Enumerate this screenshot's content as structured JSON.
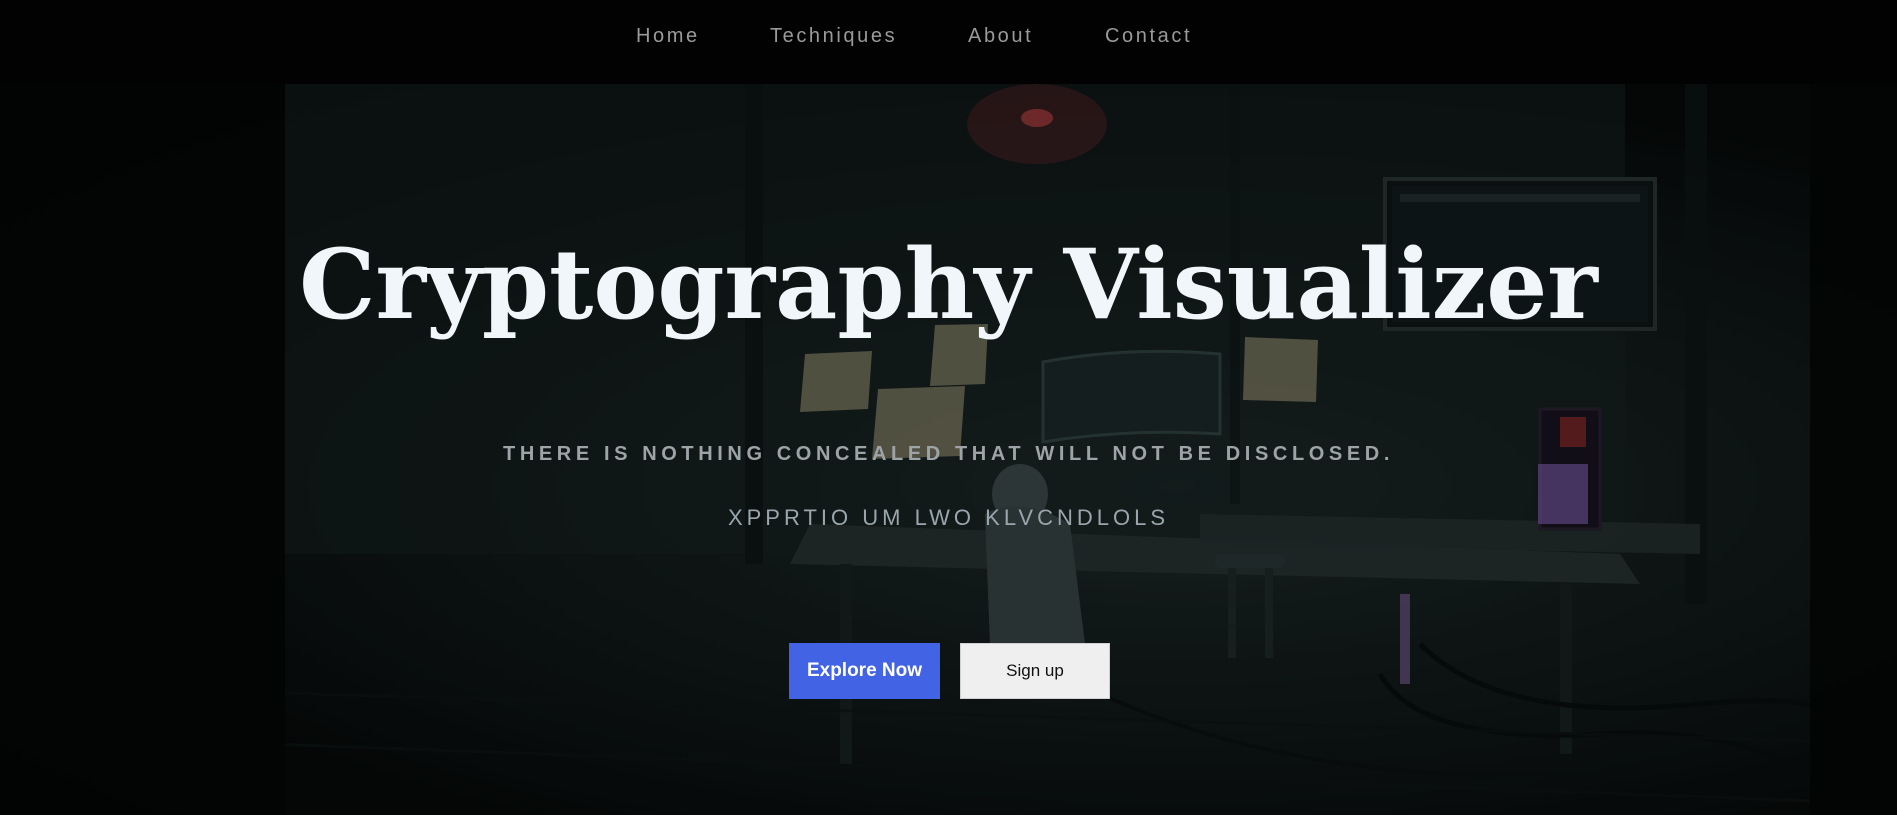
{
  "nav": {
    "items": [
      {
        "label": "Home"
      },
      {
        "label": "Techniques"
      },
      {
        "label": "About"
      },
      {
        "label": "Contact"
      }
    ]
  },
  "hero": {
    "title": "Cryptography Visualizer",
    "tagline": "THERE IS NOTHING CONCEALED THAT WILL NOT BE DISCLOSED.",
    "cipher_text": "XPPRTIO UM LWO KLVCNDLOLS",
    "background_image": "dark-hacker-room-illustration",
    "primary_button": {
      "label": "Explore Now"
    },
    "secondary_button": {
      "label": "Sign up"
    }
  },
  "colors": {
    "nav_background": "#020202",
    "nav_text": "#9a9a9a",
    "primary_button": "#4263e3",
    "secondary_button": "#efefef",
    "title_text": "#f1f6fa"
  }
}
